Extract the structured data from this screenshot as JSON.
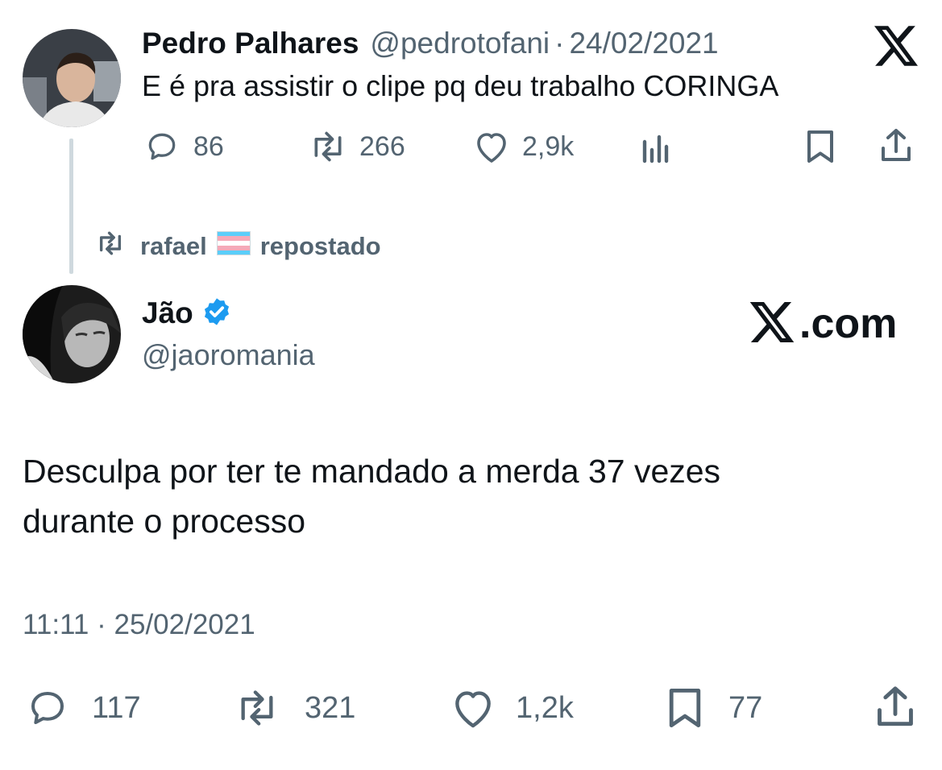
{
  "parent_tweet": {
    "display_name": "Pedro Palhares",
    "handle": "@pedrotofani",
    "separator": "·",
    "date": "24/02/2021",
    "text": "E é pra assistir o clipe pq deu trabalho CORINGA",
    "metrics": {
      "replies": "86",
      "reposts": "266",
      "likes": "2,9k"
    }
  },
  "repost_banner": {
    "name": "rafael",
    "flag_emoji": "🏳️‍⚧️",
    "label": "repostado"
  },
  "main_tweet": {
    "display_name": "Jão",
    "handle": "@jaoromania",
    "brand": "X.com",
    "text_line1": "Desculpa por ter te mandado a merda 37 vezes",
    "text_line2": "durante o processo",
    "time": "11:11",
    "separator": "·",
    "date": "25/02/2021",
    "metrics": {
      "replies": "117",
      "reposts": "321",
      "likes": "1,2k",
      "bookmarks": "77"
    }
  },
  "colors": {
    "text": "#0f1419",
    "muted": "#536471",
    "verified": "#1d9bf0",
    "thread_line": "#cfd9de"
  }
}
